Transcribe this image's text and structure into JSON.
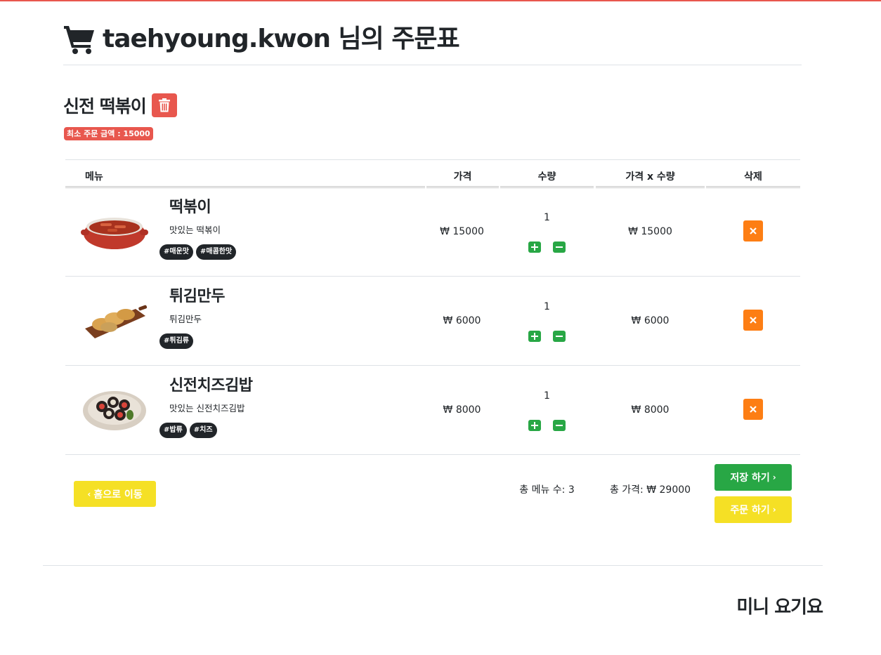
{
  "header": {
    "title": "taehyoung.kwon 님의 주문표",
    "icon": "shopping-cart-icon"
  },
  "store": {
    "name": "신전 떡볶이",
    "min_order": "최소 주문 금액 : 15000"
  },
  "table": {
    "columns": [
      "메뉴",
      "가격",
      "수량",
      "가격 x 수량",
      "삭제"
    ],
    "rows": [
      {
        "name": "떡볶이",
        "desc": "맛있는 떡볶이",
        "tags": [
          "#매운맛",
          "#매콤한맛"
        ],
        "price": "₩ 15000",
        "qty": "1",
        "subtotal": "₩ 15000",
        "image": "tteokbokki"
      },
      {
        "name": "튀김만두",
        "desc": "튀김만두",
        "tags": [
          "#튀김류"
        ],
        "price": "₩ 6000",
        "qty": "1",
        "subtotal": "₩ 6000",
        "image": "fried-dumplings"
      },
      {
        "name": "신전치즈김밥",
        "desc": "맛있는 신전치즈김밥",
        "tags": [
          "#밥류",
          "#치즈"
        ],
        "price": "₩ 8000",
        "qty": "1",
        "subtotal": "₩ 8000",
        "image": "cheese-gimbap"
      }
    ]
  },
  "summary": {
    "home_label": "홈으로 이동",
    "total_count": "총 메뉴 수: 3",
    "total_price": "총 가격: ₩ 29000",
    "save_label": "저장 하기",
    "order_label": "주문 하기"
  },
  "footer": {
    "brand": "미니 요기요"
  },
  "colors": {
    "accent_red": "#e8574e",
    "green": "#28a745",
    "orange": "#fd7e14",
    "yellow": "#f5e025",
    "dark": "#212529"
  }
}
